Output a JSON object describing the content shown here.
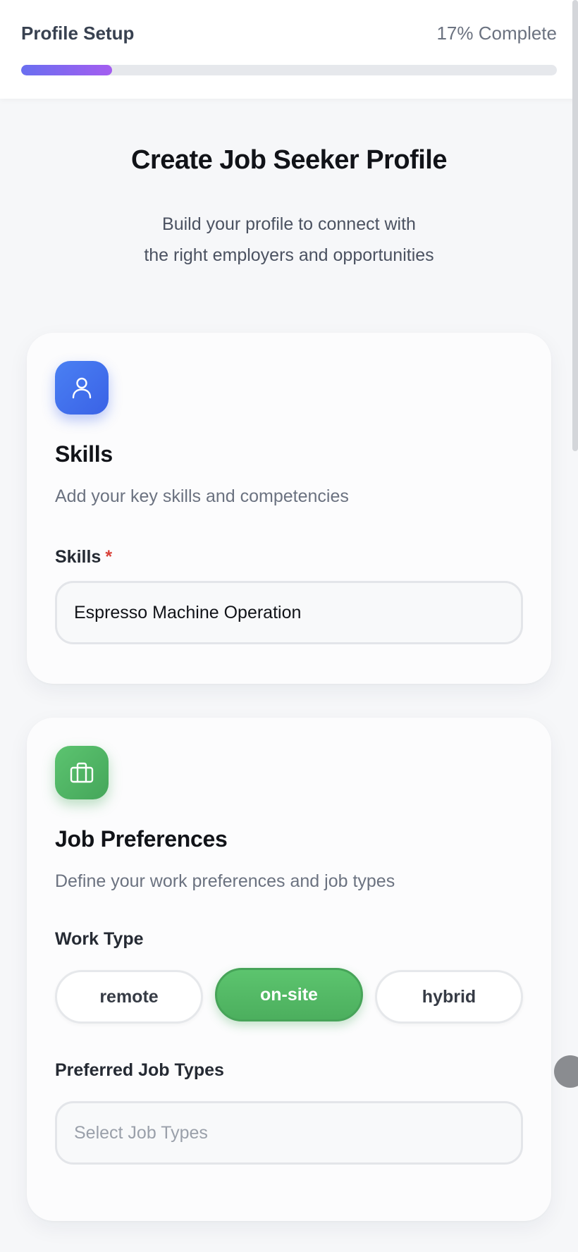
{
  "header": {
    "title": "Profile Setup",
    "progress_text": "17% Complete",
    "progress_fraction": 0.17
  },
  "intro": {
    "title": "Create Job Seeker Profile",
    "subtitle_line1": "Build your profile to connect with",
    "subtitle_line2": "the right employers and opportunities"
  },
  "skills_card": {
    "icon": "user-icon",
    "heading": "Skills",
    "description": "Add your key skills and competencies",
    "field_label": "Skills",
    "required_mark": "*",
    "field_value": "Espresso Machine Operation"
  },
  "preferences_card": {
    "icon": "briefcase-icon",
    "heading": "Job Preferences",
    "description": "Define your work preferences and job types",
    "work_type_label": "Work Type",
    "work_type_options": [
      {
        "label": "remote",
        "selected": false
      },
      {
        "label": "on-site",
        "selected": true
      },
      {
        "label": "hybrid",
        "selected": false
      }
    ],
    "job_types_label": "Preferred Job Types",
    "job_types_placeholder": "Select Job Types"
  },
  "colors": {
    "accent_purple": "#8b5cf6",
    "skills_icon_bg": "#3f6ee9",
    "prefs_icon_bg": "#4fb262",
    "selected_option_bg": "#52b864",
    "required": "#d9423a"
  }
}
